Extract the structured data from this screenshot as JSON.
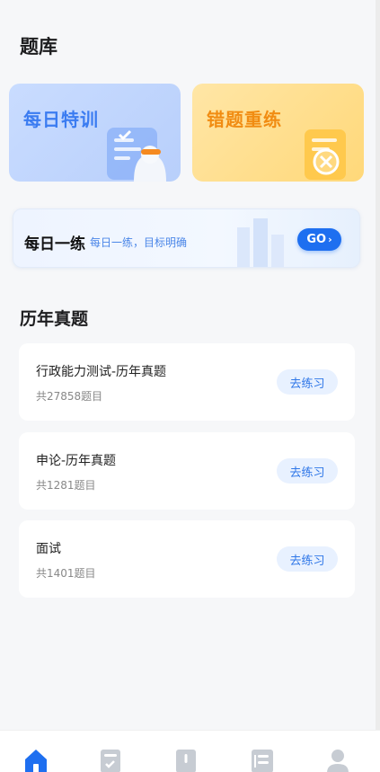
{
  "header": {
    "title": "题库"
  },
  "cards": {
    "daily_training": "每日特训",
    "wrong_review": "错题重练"
  },
  "banner": {
    "title": "每日一练",
    "subtitle": "每日一练，目标明确",
    "go_label": "GO"
  },
  "past_exams": {
    "section_title": "历年真题",
    "items": [
      {
        "name": "行政能力测试-历年真题",
        "count": "共27858题目",
        "action": "去练习"
      },
      {
        "name": "申论-历年真题",
        "count": "共1281题目",
        "action": "去练习"
      },
      {
        "name": "面试",
        "count": "共1401题目",
        "action": "去练习"
      }
    ]
  },
  "tabbar": {
    "icons": [
      "home-icon",
      "checklist-icon",
      "notice-icon",
      "news-icon",
      "user-icon"
    ],
    "active_color": "#1e6ff0",
    "inactive_color": "#c7ccd3"
  }
}
